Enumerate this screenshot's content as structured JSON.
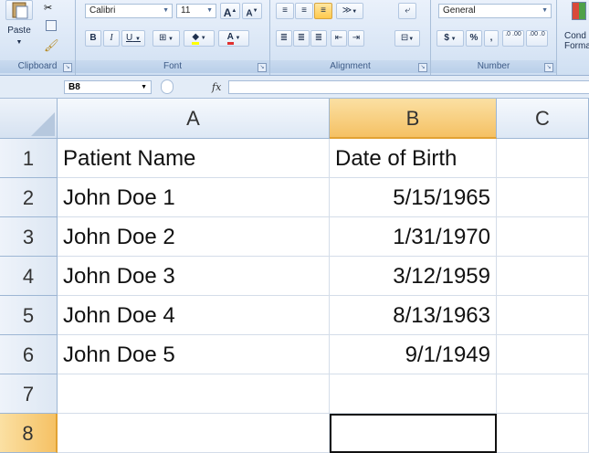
{
  "ribbon": {
    "clipboard": {
      "paste_label": "Paste",
      "group_label": "Clipboard"
    },
    "font": {
      "font_name": "Calibri",
      "font_size": "11",
      "bold": "B",
      "italic": "I",
      "underline": "U",
      "grow_font": "A",
      "shrink_font": "A",
      "font_color": "A",
      "group_label": "Font"
    },
    "alignment": {
      "group_label": "Alignment"
    },
    "number": {
      "format": "General",
      "currency": "$",
      "percent": "%",
      "comma": ",",
      "inc_decimal": ".0 .00",
      "dec_decimal": ".00 .0",
      "group_label": "Number"
    },
    "styles": {
      "conditional_label_1": "Cond",
      "conditional_label_2": "Forma"
    }
  },
  "formula_bar": {
    "name_box": "B8",
    "fx": "fx",
    "value": ""
  },
  "sheet": {
    "columns": [
      "A",
      "B",
      "C"
    ],
    "selected_column": "B",
    "rows": [
      {
        "num": "1",
        "a": "Patient Name",
        "b": "Date of Birth"
      },
      {
        "num": "2",
        "a": "John Doe 1",
        "b": "5/15/1965"
      },
      {
        "num": "3",
        "a": "John Doe 2",
        "b": "1/31/1970"
      },
      {
        "num": "4",
        "a": "John Doe 3",
        "b": "3/12/1959"
      },
      {
        "num": "5",
        "a": "John Doe 4",
        "b": "8/13/1963"
      },
      {
        "num": "6",
        "a": "John Doe 5",
        "b": "9/1/1949"
      },
      {
        "num": "7",
        "a": "",
        "b": ""
      },
      {
        "num": "8",
        "a": "",
        "b": ""
      }
    ],
    "selected_row": "8",
    "active_cell": "B8"
  }
}
